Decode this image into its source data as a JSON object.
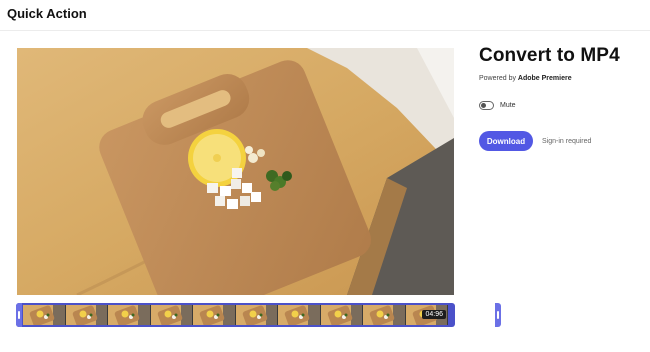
{
  "header": {
    "title": "Quick Action"
  },
  "panel": {
    "title": "Convert to MP4",
    "powered_prefix": "Powered by ",
    "powered_brand": "Adobe Premiere",
    "mute_label": "Mute",
    "mute_on": false,
    "download_label": "Download",
    "signin_note": "Sign-in required",
    "accent_color": "#5258e4"
  },
  "timeline": {
    "duration_label": "04:96",
    "frame_count": 10
  }
}
